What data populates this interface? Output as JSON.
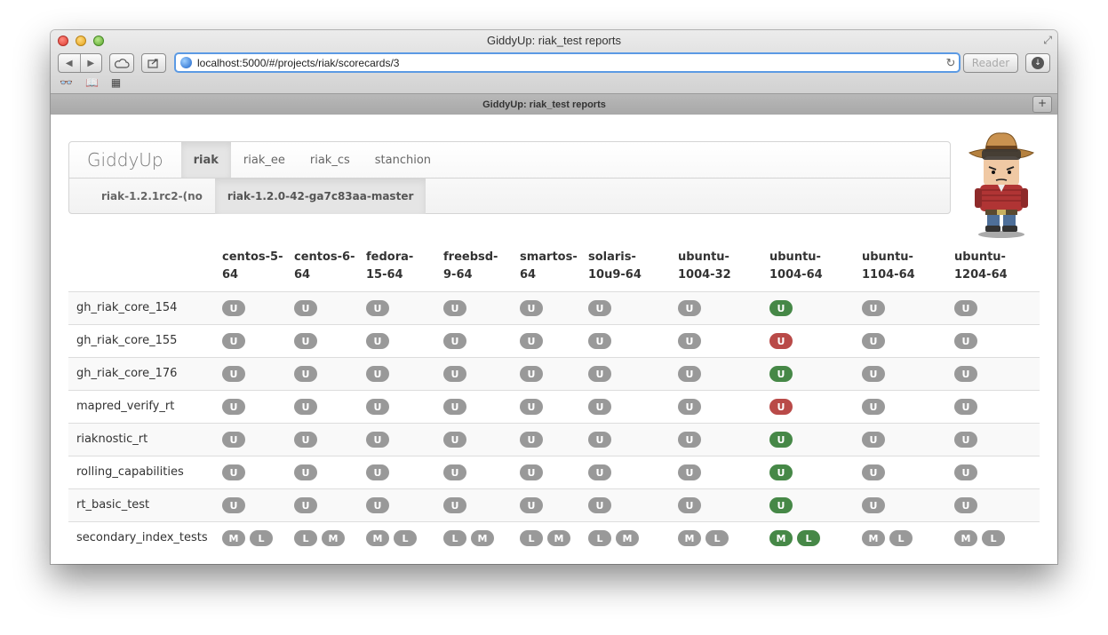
{
  "window": {
    "title": "GiddyUp: riak_test reports",
    "url": "localhost:5000/#/projects/riak/scorecards/3",
    "reader_label": "Reader",
    "tab_title": "GiddyUp: riak_test reports"
  },
  "toolbar_icons": {
    "back": "back-arrow-icon",
    "forward": "forward-arrow-icon",
    "icloud": "cloud-icon",
    "share": "share-icon",
    "reload": "reload-icon",
    "download": "download-icon",
    "reading_list": "glasses-icon",
    "bookmarks": "book-icon",
    "top_sites": "grid-icon"
  },
  "navbar": {
    "brand": "GiddyUp",
    "projects": [
      {
        "label": "riak",
        "active": true
      },
      {
        "label": "riak_ee",
        "active": false
      },
      {
        "label": "riak_cs",
        "active": false
      },
      {
        "label": "stanchion",
        "active": false
      }
    ],
    "scorecards": [
      {
        "label": "riak-1.2.1rc2-(no",
        "active": false
      },
      {
        "label": "riak-1.2.0-42-ga7c83aa-master",
        "active": true
      }
    ]
  },
  "platforms": [
    "centos-5-\n64",
    "centos-6-\n64",
    "fedora-\n15-64",
    "freebsd-\n9-64",
    "smartos-\n64",
    "solaris-\n10u9-64",
    "ubuntu-\n1004-32",
    "ubuntu-\n1004-64",
    "ubuntu-\n1104-64",
    "ubuntu-\n1204-64"
  ],
  "rows": [
    {
      "name": "gh_riak_core_154",
      "cells": [
        [
          "U"
        ],
        [
          "U"
        ],
        [
          "U"
        ],
        [
          "U"
        ],
        [
          "U"
        ],
        [
          "U"
        ],
        [
          "U"
        ],
        [
          "U:pass"
        ],
        [
          "U"
        ],
        [
          "U"
        ]
      ]
    },
    {
      "name": "gh_riak_core_155",
      "cells": [
        [
          "U"
        ],
        [
          "U"
        ],
        [
          "U"
        ],
        [
          "U"
        ],
        [
          "U"
        ],
        [
          "U"
        ],
        [
          "U"
        ],
        [
          "U:fail"
        ],
        [
          "U"
        ],
        [
          "U"
        ]
      ]
    },
    {
      "name": "gh_riak_core_176",
      "cells": [
        [
          "U"
        ],
        [
          "U"
        ],
        [
          "U"
        ],
        [
          "U"
        ],
        [
          "U"
        ],
        [
          "U"
        ],
        [
          "U"
        ],
        [
          "U:pass"
        ],
        [
          "U"
        ],
        [
          "U"
        ]
      ]
    },
    {
      "name": "mapred_verify_rt",
      "cells": [
        [
          "U"
        ],
        [
          "U"
        ],
        [
          "U"
        ],
        [
          "U"
        ],
        [
          "U"
        ],
        [
          "U"
        ],
        [
          "U"
        ],
        [
          "U:fail"
        ],
        [
          "U"
        ],
        [
          "U"
        ]
      ]
    },
    {
      "name": "riaknostic_rt",
      "cells": [
        [
          "U"
        ],
        [
          "U"
        ],
        [
          "U"
        ],
        [
          "U"
        ],
        [
          "U"
        ],
        [
          "U"
        ],
        [
          "U"
        ],
        [
          "U:pass"
        ],
        [
          "U"
        ],
        [
          "U"
        ]
      ]
    },
    {
      "name": "rolling_capabilities",
      "cells": [
        [
          "U"
        ],
        [
          "U"
        ],
        [
          "U"
        ],
        [
          "U"
        ],
        [
          "U"
        ],
        [
          "U"
        ],
        [
          "U"
        ],
        [
          "U:pass"
        ],
        [
          "U"
        ],
        [
          "U"
        ]
      ]
    },
    {
      "name": "rt_basic_test",
      "cells": [
        [
          "U"
        ],
        [
          "U"
        ],
        [
          "U"
        ],
        [
          "U"
        ],
        [
          "U"
        ],
        [
          "U"
        ],
        [
          "U"
        ],
        [
          "U:pass"
        ],
        [
          "U"
        ],
        [
          "U"
        ]
      ]
    },
    {
      "name": "secondary_index_tests",
      "cells": [
        [
          "M",
          "L"
        ],
        [
          "L",
          "M"
        ],
        [
          "M",
          "L"
        ],
        [
          "L",
          "M"
        ],
        [
          "L",
          "M"
        ],
        [
          "L",
          "M"
        ],
        [
          "M",
          "L"
        ],
        [
          "M:pass",
          "L:pass"
        ],
        [
          "M",
          "L"
        ],
        [
          "M",
          "L"
        ]
      ]
    }
  ]
}
